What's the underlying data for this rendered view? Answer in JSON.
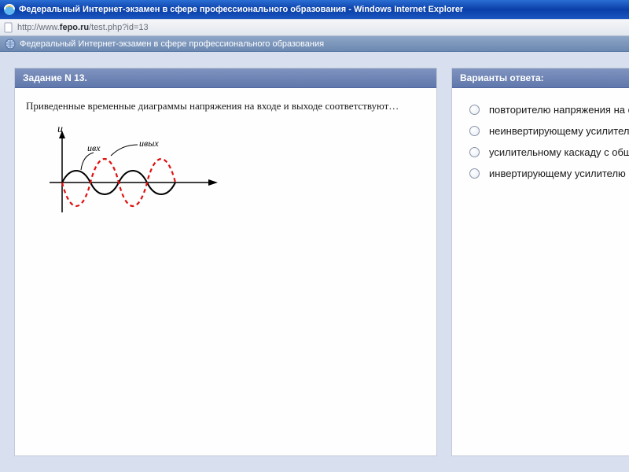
{
  "window": {
    "title": "Федеральный Интернет-экзамен в сфере профессионального образования - Windows Internet Explorer"
  },
  "address": {
    "prefix": "http://www.",
    "host": "fepo.ru",
    "path": "/test.php?id=13"
  },
  "page_header": {
    "title": "Федеральный Интернет-экзамен в сфере профессионального образования"
  },
  "task": {
    "title": "Задание N 13.",
    "prompt": "Приведенные временные диаграммы напряжения на входе и выходе соответствуют…",
    "diagram": {
      "y_label": "u",
      "in_label": "uвх",
      "out_label": "uвых"
    }
  },
  "answers": {
    "title": "Варианты ответа:",
    "items": [
      "повторителю напряжения на о",
      "неинвертирующему усилител",
      "усилительному каскаду с общ",
      "инвертирующему усилителю"
    ]
  }
}
